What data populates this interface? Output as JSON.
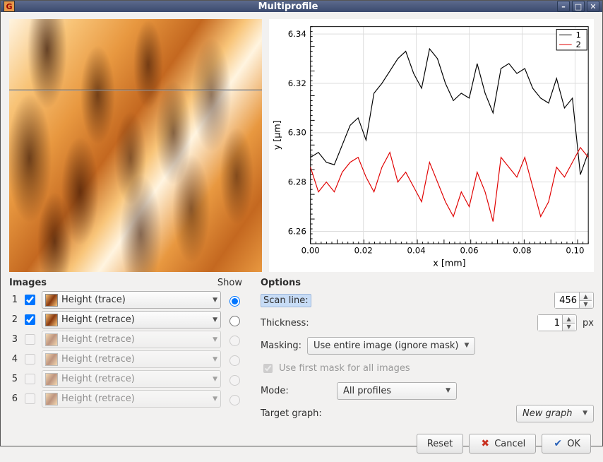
{
  "window": {
    "title": "Multiprofile"
  },
  "images": {
    "header": "Images",
    "show_label": "Show",
    "rows": [
      {
        "num": "1",
        "checked": true,
        "enabled": true,
        "label": "Height (trace)",
        "radio": true
      },
      {
        "num": "2",
        "checked": true,
        "enabled": true,
        "label": "Height (retrace)",
        "radio": false
      },
      {
        "num": "3",
        "checked": false,
        "enabled": false,
        "label": "Height (retrace)",
        "radio": false
      },
      {
        "num": "4",
        "checked": false,
        "enabled": false,
        "label": "Height (retrace)",
        "radio": false
      },
      {
        "num": "5",
        "checked": false,
        "enabled": false,
        "label": "Height (retrace)",
        "radio": false
      },
      {
        "num": "6",
        "checked": false,
        "enabled": false,
        "label": "Height (retrace)",
        "radio": false
      }
    ]
  },
  "options": {
    "header": "Options",
    "scan_line_label": "Scan line:",
    "scan_line_value": "456",
    "thickness_label": "Thickness:",
    "thickness_value": "1",
    "thickness_unit": "px",
    "masking_label": "Masking:",
    "masking_value": "Use entire image (ignore mask)",
    "use_first_mask": "Use first mask for all images",
    "mode_label": "Mode:",
    "mode_value": "All profiles",
    "target_label": "Target graph:",
    "target_value": "New graph"
  },
  "buttons": {
    "reset": "Reset",
    "cancel": "Cancel",
    "ok": "OK"
  },
  "legend": {
    "s1": "1",
    "s2": "2"
  },
  "chart_data": {
    "type": "line",
    "title": "",
    "xlabel": "x [mm]",
    "ylabel": "y [µm]",
    "xlim": [
      0.0,
      0.105
    ],
    "ylim": [
      6.255,
      6.343
    ],
    "xticks": [
      0.0,
      0.02,
      0.04,
      0.06,
      0.08,
      0.1
    ],
    "yticks": [
      6.26,
      6.28,
      6.3,
      6.32,
      6.34
    ],
    "series": [
      {
        "name": "1",
        "color": "#000000",
        "x": [
          0.0,
          0.003,
          0.006,
          0.009,
          0.012,
          0.015,
          0.018,
          0.021,
          0.024,
          0.027,
          0.03,
          0.033,
          0.036,
          0.039,
          0.042,
          0.045,
          0.048,
          0.051,
          0.054,
          0.057,
          0.06,
          0.063,
          0.066,
          0.069,
          0.072,
          0.075,
          0.078,
          0.081,
          0.084,
          0.087,
          0.09,
          0.093,
          0.096,
          0.099,
          0.102,
          0.105
        ],
        "y": [
          6.29,
          6.292,
          6.288,
          6.287,
          6.295,
          6.303,
          6.306,
          6.297,
          6.316,
          6.32,
          6.325,
          6.33,
          6.333,
          6.324,
          6.318,
          6.334,
          6.33,
          6.32,
          6.313,
          6.316,
          6.314,
          6.328,
          6.316,
          6.308,
          6.326,
          6.328,
          6.324,
          6.326,
          6.318,
          6.314,
          6.312,
          6.322,
          6.31,
          6.314,
          6.283,
          6.292
        ]
      },
      {
        "name": "2",
        "color": "#e00000",
        "x": [
          0.0,
          0.003,
          0.006,
          0.009,
          0.012,
          0.015,
          0.018,
          0.021,
          0.024,
          0.027,
          0.03,
          0.033,
          0.036,
          0.039,
          0.042,
          0.045,
          0.048,
          0.051,
          0.054,
          0.057,
          0.06,
          0.063,
          0.066,
          0.069,
          0.072,
          0.075,
          0.078,
          0.081,
          0.084,
          0.087,
          0.09,
          0.093,
          0.096,
          0.099,
          0.102,
          0.105
        ],
        "y": [
          6.286,
          6.276,
          6.28,
          6.276,
          6.284,
          6.288,
          6.29,
          6.282,
          6.276,
          6.286,
          6.292,
          6.28,
          6.284,
          6.278,
          6.272,
          6.288,
          6.28,
          6.272,
          6.266,
          6.276,
          6.27,
          6.284,
          6.276,
          6.264,
          6.29,
          6.286,
          6.282,
          6.29,
          6.278,
          6.266,
          6.272,
          6.286,
          6.282,
          6.288,
          6.294,
          6.29
        ]
      }
    ]
  }
}
